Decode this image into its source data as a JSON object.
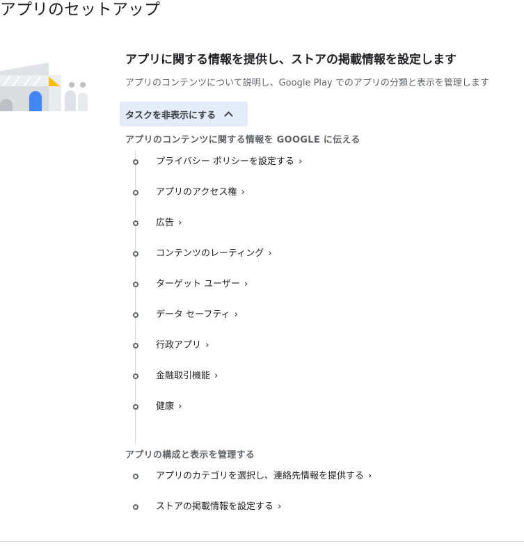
{
  "page": {
    "title": "アプリのセットアップ"
  },
  "setup_section": {
    "heading": "アプリに関する情報を提供し、ストアの掲載情報を設定します",
    "description": "アプリのコンテンツについて説明し、Google Play でのアプリの分類と表示を管理します",
    "toggle_label": "タスクを非表示にする",
    "toggle_icon": "chevron-up-icon"
  },
  "groups": [
    {
      "label": "アプリのコンテンツに関する情報を GOOGLE に伝える",
      "tasks": [
        {
          "label": "プライバシー ポリシーを設定する"
        },
        {
          "label": "アプリのアクセス権"
        },
        {
          "label": "広告"
        },
        {
          "label": "コンテンツのレーティング"
        },
        {
          "label": "ターゲット ユーザー"
        },
        {
          "label": "データ セーフティ"
        },
        {
          "label": "行政アプリ"
        },
        {
          "label": "金融取引機能"
        },
        {
          "label": "健康"
        }
      ]
    },
    {
      "label": "アプリの構成と表示を管理する",
      "tasks": [
        {
          "label": "アプリのカテゴリを選択し、連絡先情報を提供する"
        },
        {
          "label": "ストアの掲載情報を設定する"
        }
      ]
    }
  ],
  "task_chevron": "›",
  "colors": {
    "accent_blue": "#4285f4",
    "accent_yellow": "#fbbc04",
    "button_bg": "#e3ecf8",
    "text_secondary": "#5f6368"
  }
}
